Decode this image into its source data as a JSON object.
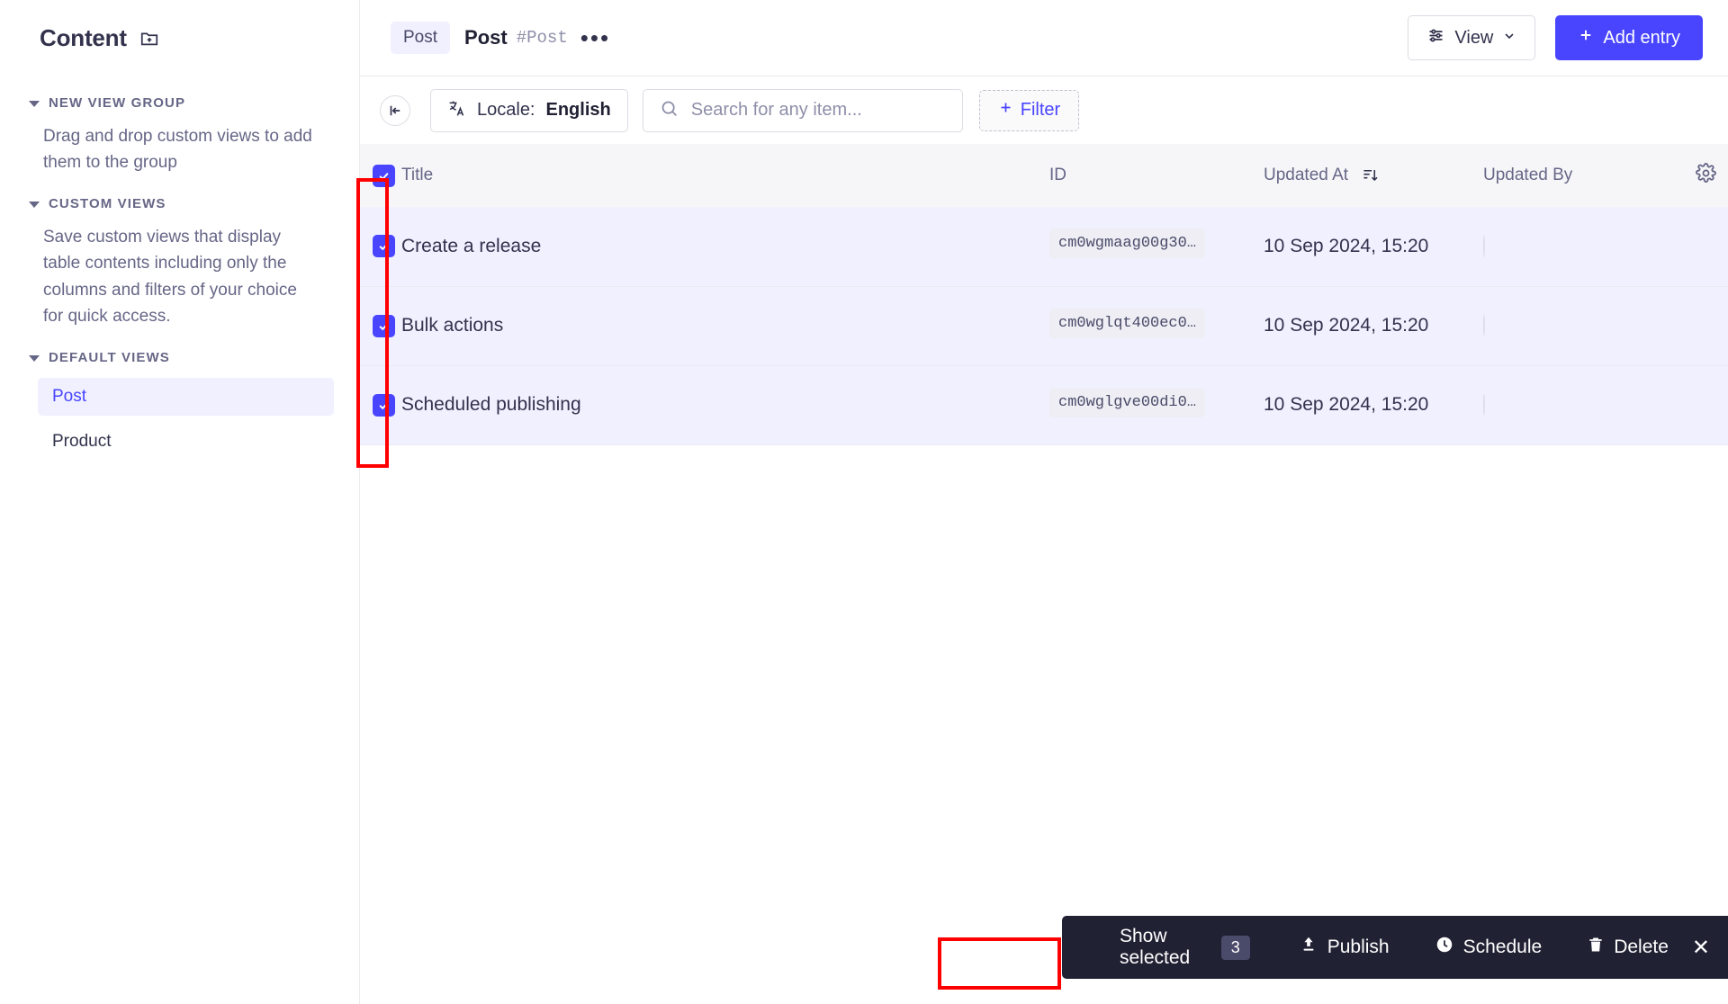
{
  "sidebar": {
    "title": "Content",
    "add_icon": "folder-add-icon",
    "groups": [
      {
        "label": "NEW VIEW GROUP",
        "description": "Drag and drop custom views to add them to the group",
        "items": []
      },
      {
        "label": "CUSTOM VIEWS",
        "description": "Save custom views that display table contents including only the columns and filters of your choice for quick access.",
        "items": []
      },
      {
        "label": "DEFAULT VIEWS",
        "description": "",
        "items": [
          {
            "label": "Post",
            "active": true
          },
          {
            "label": "Product",
            "active": false
          }
        ]
      }
    ]
  },
  "header": {
    "breadcrumb_pill": "Post",
    "title": "Post",
    "uid": "#Post",
    "more_icon": "ellipsis-icon",
    "view_button": "View",
    "view_icon": "sliders-icon",
    "add_entry_button": "Add entry",
    "add_icon": "plus-icon"
  },
  "toolbar": {
    "collapse_icon": "collapse-left-icon",
    "locale_icon": "translate-icon",
    "locale_label": "Locale:",
    "locale_value": "English",
    "search_icon": "search-icon",
    "search_placeholder": "Search for any item...",
    "search_value": "",
    "filter_button": "Filter",
    "filter_icon": "plus-icon"
  },
  "table": {
    "columns": [
      {
        "key": "title",
        "label": "Title"
      },
      {
        "key": "id",
        "label": "ID"
      },
      {
        "key": "updated_at",
        "label": "Updated At",
        "sort_icon": "sort-desc-icon"
      },
      {
        "key": "updated_by",
        "label": "Updated By"
      }
    ],
    "settings_icon": "gear-icon",
    "header_checkbox_checked": true,
    "rows": [
      {
        "checked": true,
        "title": "Create a release",
        "id": "cm0wgmaag00g30…",
        "updated_at": "10 Sep 2024, 15:20",
        "updated_by": "avatar"
      },
      {
        "checked": true,
        "title": "Bulk actions",
        "id": "cm0wglqt400ec0…",
        "updated_at": "10 Sep 2024, 15:20",
        "updated_by": "avatar"
      },
      {
        "checked": true,
        "title": "Scheduled publishing",
        "id": "cm0wglgve00di0…",
        "updated_at": "10 Sep 2024, 15:20",
        "updated_by": "avatar"
      }
    ]
  },
  "bulk_bar": {
    "show_selected_label": "Show selected",
    "selected_count": "3",
    "publish_label": "Publish",
    "publish_icon": "upload-cloud-icon",
    "schedule_label": "Schedule",
    "schedule_icon": "clock-icon",
    "delete_label": "Delete",
    "delete_icon": "trash-icon",
    "close_icon": "close-icon"
  },
  "colors": {
    "accent": "#4945ff",
    "accent_soft": "#f0f0ff",
    "text": "#32324d",
    "muted": "#666687",
    "border": "#eaeaef",
    "header_bg": "#f6f6f9",
    "dark_bar": "#212134",
    "annotation": "#ff0000"
  }
}
